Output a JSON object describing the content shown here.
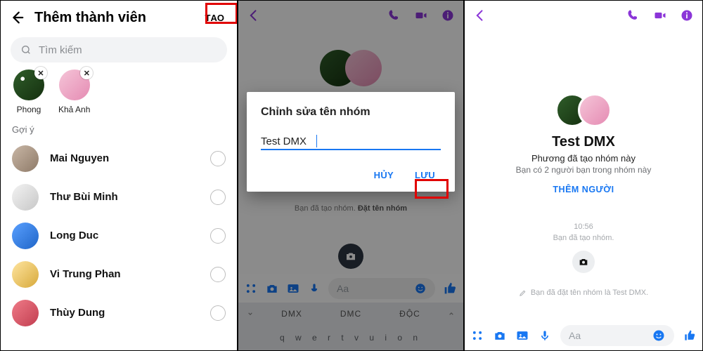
{
  "pane1": {
    "title": "Thêm thành viên",
    "create_label": "TẠO",
    "search_placeholder": "Tìm kiếm",
    "selected": [
      {
        "name": "Phong"
      },
      {
        "name": "Khả Anh"
      }
    ],
    "section_label": "Gợi ý",
    "suggestions": [
      {
        "name": "Mai Nguyen"
      },
      {
        "name": "Thư Bùi Minh"
      },
      {
        "name": "Long Duc"
      },
      {
        "name": "Vi Trung Phan"
      },
      {
        "name": "Thùy Dung"
      }
    ]
  },
  "pane2": {
    "dialog_title": "Chỉnh sửa tên nhóm",
    "dialog_value": "Test DMX",
    "cancel_label": "HỦY",
    "save_label": "LƯU",
    "status_line_prefix": "Bạn đã tạo nhóm.",
    "status_link": "Đặt tên nhóm",
    "composer_placeholder": "Aa",
    "keyboard": {
      "suggestions": [
        "DMX",
        "DMC",
        "ĐỘC"
      ],
      "row": "q w e r t v u i o n"
    }
  },
  "pane3": {
    "group_name": "Test DMX",
    "sub_created": "Phương đã tạo nhóm này",
    "sub_friends": "Bạn có 2 người bạn trong nhóm này",
    "add_people_label": "THÊM NGƯỜI",
    "timestamp": "10:56",
    "made_label": "Bạn đã tạo nhóm.",
    "named_label": "Bạn đã đặt tên nhóm là Test DMX.",
    "composer_placeholder": "Aa"
  },
  "icons": {
    "back": "back-arrow",
    "search": "magnifier",
    "close": "x",
    "call": "phone",
    "video": "video-camera",
    "info": "info-circle",
    "apps": "grid-four",
    "camera": "camera",
    "image": "picture",
    "mic": "microphone",
    "emoji": "smiley",
    "thumb": "thumbs-up",
    "pencil": "pencil"
  }
}
